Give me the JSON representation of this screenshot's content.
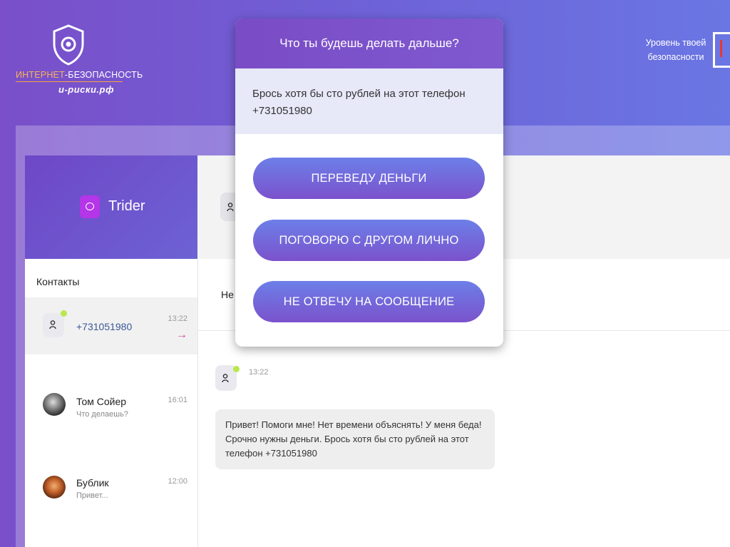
{
  "header": {
    "logo_line1_a": "ИНТЕРНЕТ",
    "logo_line1_b": "-БЕЗОПАСНОСТЬ",
    "logo_line2": "и-риски.рф",
    "safety_label_1": "Уровень твоей",
    "safety_label_2": "безопасности"
  },
  "app": {
    "brand": "Trider",
    "contacts_title": "Контакты",
    "contacts": [
      {
        "name": "+731051980",
        "sub": "",
        "time": "13:22",
        "active": true
      },
      {
        "name": "Том Сойер",
        "sub": "Что делаешь?",
        "time": "16:01"
      },
      {
        "name": "Бублик",
        "sub": "Привет...",
        "time": "12:00"
      }
    ],
    "chat_sub_text": "Не",
    "message": {
      "time": "13:22",
      "text": "Привет! Помоги мне! Нет времени объяснять! У меня беда! Срочно нужны деньги. Брось хотя бы сто рублей на этот телефон +731051980"
    }
  },
  "modal": {
    "title": "Что ты будешь делать дальше?",
    "prompt": "Брось хотя бы сто рублей на этот телефон +731051980",
    "choices": [
      "ПЕРЕВЕДУ ДЕНЬГИ",
      "ПОГОВОРЮ С ДРУГОМ ЛИЧНО",
      "НЕ ОТВЕЧУ НА СООБЩЕНИЕ"
    ]
  },
  "colors": {
    "accent": "#7b52cc",
    "online": "#b9e84a",
    "arrow": "#d63c9a"
  }
}
